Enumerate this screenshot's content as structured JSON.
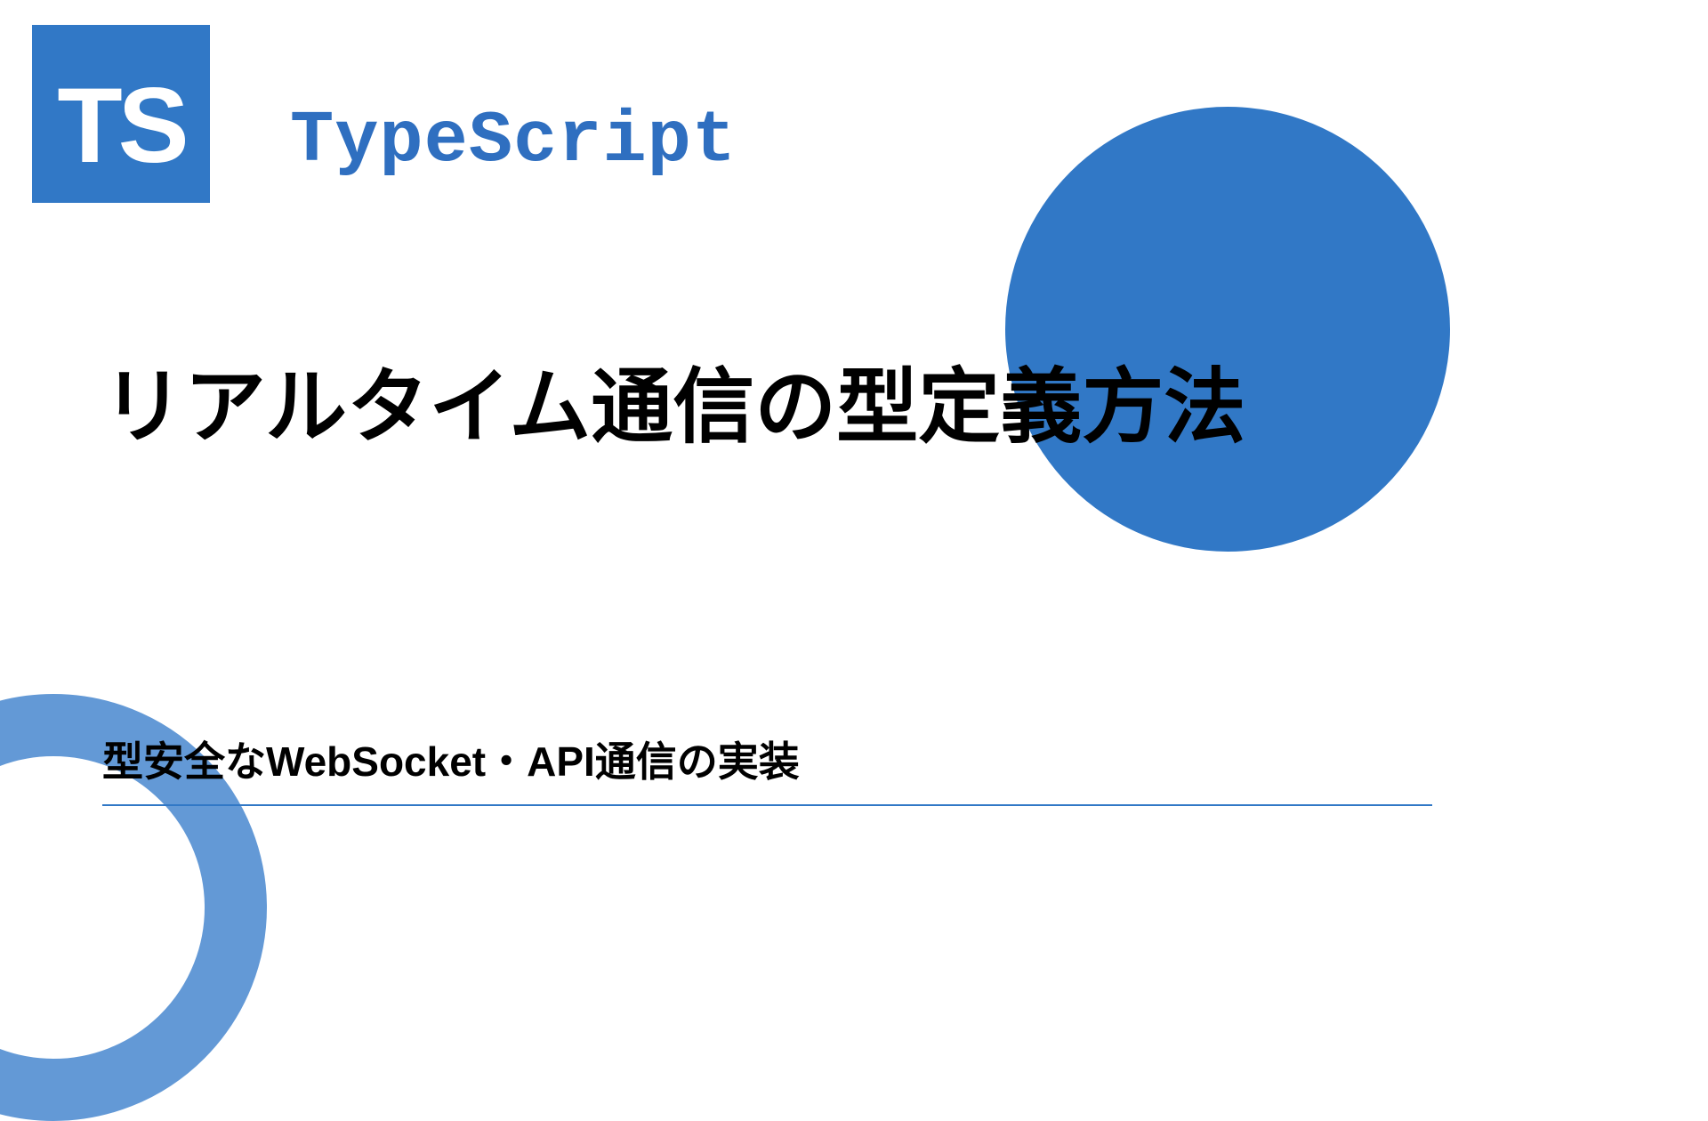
{
  "logo": {
    "badge_text": "TS",
    "brand_label": "TypeScript"
  },
  "main_title": "リアルタイム通信の型定義方法",
  "subtitle": "型安全なWebSocket・API通信の実装",
  "colors": {
    "primary": "#3178c6",
    "ring": "#6399d6"
  }
}
